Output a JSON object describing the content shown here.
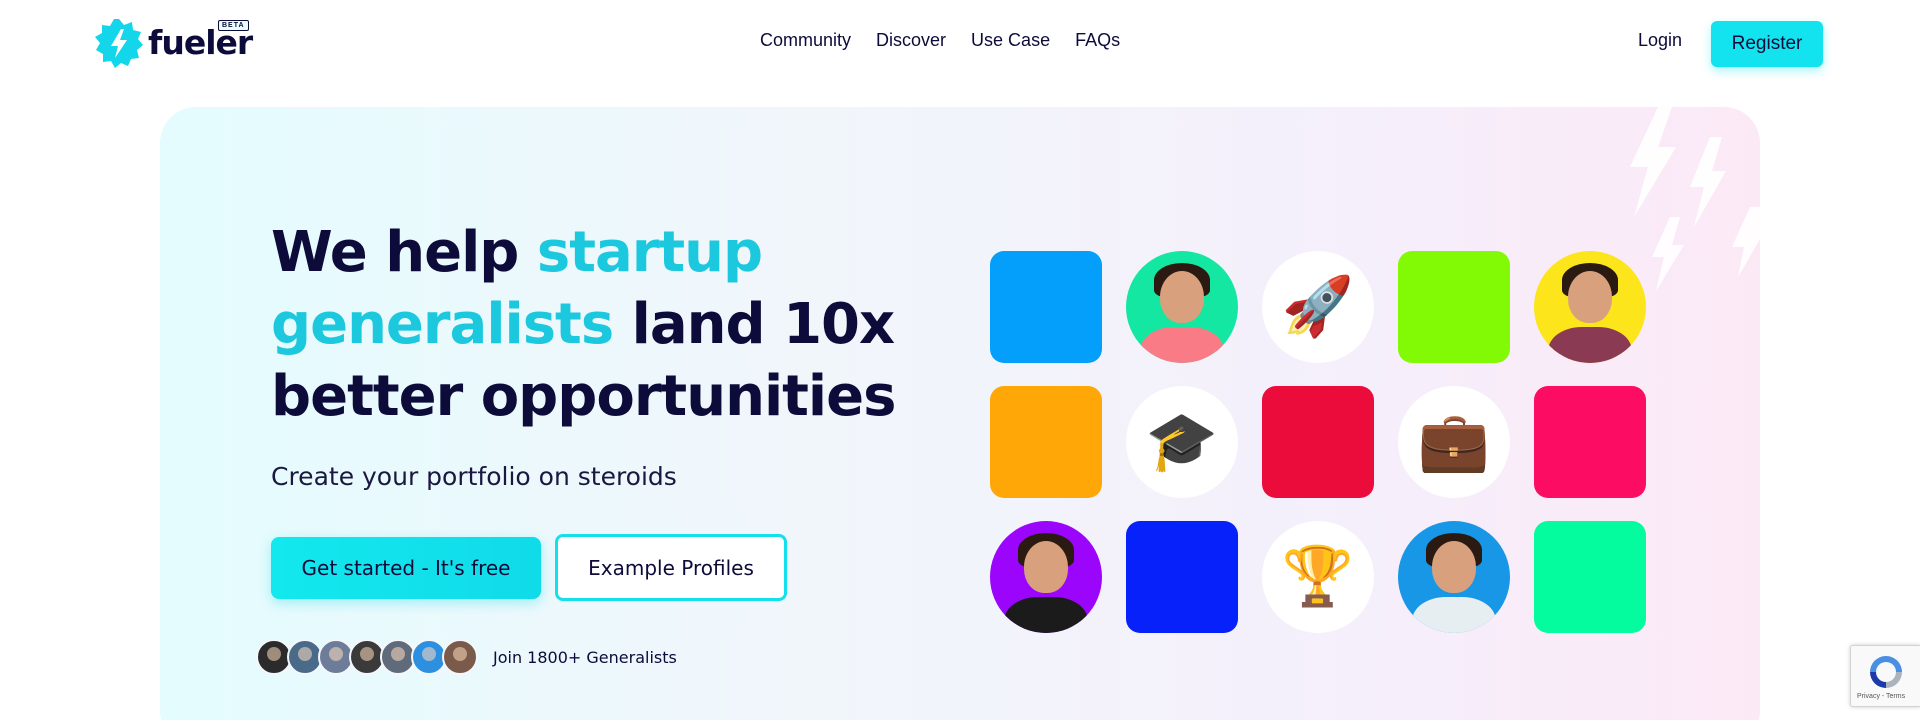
{
  "nav": {
    "logo_text": "fueler",
    "beta_label": "BETA",
    "links": [
      "Community",
      "Discover",
      "Use Case",
      "FAQs"
    ],
    "login_label": "Login",
    "register_label": "Register"
  },
  "hero": {
    "headline": {
      "part1": "We help ",
      "accent": "startup generalists",
      "part2": " land 10x better opportunities"
    },
    "subline": "Create your portfolio on steroids",
    "cta_primary": "Get started - It's free",
    "cta_secondary": "Example Profiles",
    "join_text": "Join 1800+ Generalists"
  },
  "tiles": [
    {
      "kind": "color",
      "color": "#039ffb"
    },
    {
      "kind": "person",
      "bg": "#14e7a2",
      "shirt": "#f97b86"
    },
    {
      "kind": "emoji",
      "icon": "rocket-icon",
      "glyph": "🚀"
    },
    {
      "kind": "color",
      "color": "#83fa05"
    },
    {
      "kind": "person",
      "bg": "#fce51b",
      "shirt": "#8a3a52"
    },
    {
      "kind": "color",
      "color": "#fea707"
    },
    {
      "kind": "emoji",
      "icon": "graduation-cap-icon",
      "glyph": "🎓"
    },
    {
      "kind": "color",
      "color": "#ec0c3c"
    },
    {
      "kind": "emoji",
      "icon": "briefcase-icon",
      "glyph": "💼"
    },
    {
      "kind": "color",
      "color": "#fc0d63"
    },
    {
      "kind": "person",
      "bg": "#9b05fb",
      "shirt": "#1b1b1b"
    },
    {
      "kind": "color",
      "color": "#0721fb"
    },
    {
      "kind": "emoji",
      "icon": "trophy-icon",
      "glyph": "🏆"
    },
    {
      "kind": "person",
      "bg": "#1897e6",
      "shirt": "#e6eef2"
    },
    {
      "kind": "color",
      "color": "#04fc9e"
    }
  ],
  "avatar_colors": [
    "#2b2b2b",
    "#4a6a8a",
    "#6d7d99",
    "#3a3a3a",
    "#5f6b7a",
    "#2d8fe0",
    "#7a5a4a"
  ],
  "colors": {
    "accent": "#1cc8dd",
    "brand_cyan": "#12e3ee",
    "text_dark": "#0d0b3a"
  }
}
